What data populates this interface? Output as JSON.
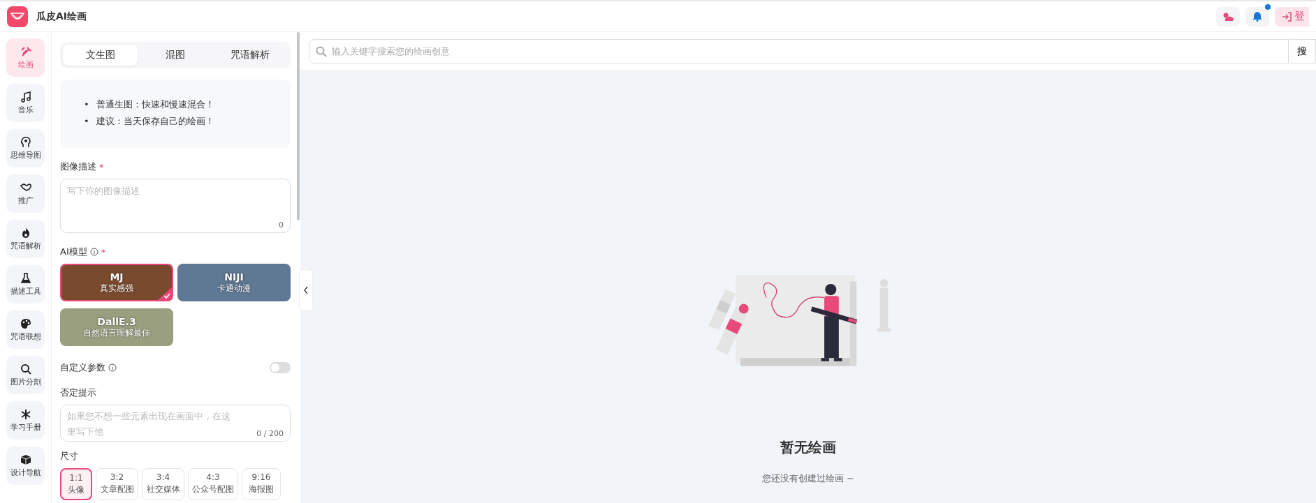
{
  "app": {
    "title": "瓜皮AI绘画"
  },
  "header_actions": {
    "login_label": "登"
  },
  "sidebar": {
    "items": [
      {
        "label": "绘画",
        "selected": true
      },
      {
        "label": "音乐",
        "selected": false
      },
      {
        "label": "思维导图",
        "selected": false
      },
      {
        "label": "推广",
        "selected": false
      },
      {
        "label": "咒语解析",
        "selected": false
      },
      {
        "label": "描述工具",
        "selected": false
      },
      {
        "label": "咒语联想",
        "selected": false
      },
      {
        "label": "图片分割",
        "selected": false
      },
      {
        "label": "学习手册",
        "selected": false
      },
      {
        "label": "设计导航",
        "selected": false
      }
    ]
  },
  "panel": {
    "tabs": [
      {
        "label": "文生图",
        "selected": true
      },
      {
        "label": "混图",
        "selected": false
      },
      {
        "label": "咒语解析",
        "selected": false
      }
    ],
    "notices": [
      {
        "bullet": "•",
        "text": "普通生图：快速和慢速混合！"
      },
      {
        "bullet": "•",
        "text": "建议：当天保存自己的绘画！"
      }
    ],
    "description": {
      "label": "图像描述",
      "required_mark": "*",
      "placeholder": "写下你的图像描述",
      "counter": "0"
    },
    "model": {
      "label": "AI模型",
      "required_mark": "*",
      "options": [
        {
          "name": "MJ",
          "subtitle": "真实感强",
          "color": "#7a4a2e",
          "selected": true
        },
        {
          "name": "NIJI",
          "subtitle": "卡通动漫",
          "color": "#5f7893",
          "selected": false
        },
        {
          "name": "DallE.3",
          "subtitle": "自然语言理解最佳",
          "color": "#9a9f80",
          "selected": false
        }
      ]
    },
    "custom_params": {
      "label": "自定义参数",
      "on": false
    },
    "negative": {
      "label": "否定提示",
      "placeholder": "如果您不想一些元素出现在画面中，在这里写下他",
      "counter": "0 / 200"
    },
    "size": {
      "label": "尺寸",
      "options": [
        {
          "ratio": "1:1",
          "caption": "头像",
          "selected": true
        },
        {
          "ratio": "3:2",
          "caption": "文章配图",
          "selected": false
        },
        {
          "ratio": "3:4",
          "caption": "社交媒体",
          "selected": false
        },
        {
          "ratio": "4:3",
          "caption": "公众号配图",
          "selected": false
        },
        {
          "ratio": "9:16",
          "caption": "海报图",
          "selected": false
        }
      ]
    }
  },
  "search": {
    "placeholder": "输入关键字搜索您的绘画创意",
    "button": "搜"
  },
  "empty_state": {
    "title": "暂无绘画",
    "message": "您还没有创建过绘画 ~"
  }
}
